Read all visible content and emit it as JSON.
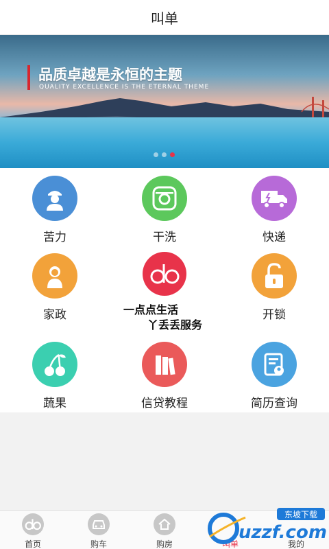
{
  "header": {
    "title": "叫单"
  },
  "banner": {
    "headline": "品质卓越是永恒的主题",
    "subline": "QUALITY EXCELLENCE IS THE ETERNAL THEME",
    "dots": 3,
    "active_dot": 3
  },
  "services": [
    {
      "label": "苦力",
      "icon": "worker-icon",
      "color": "#4a8fd6"
    },
    {
      "label": "干洗",
      "icon": "camera-icon",
      "color": "#5cc85c"
    },
    {
      "label": "快递",
      "icon": "delivery-truck-icon",
      "color": "#b76ad8"
    },
    {
      "label": "家政",
      "icon": "housekeeper-icon",
      "color": "#f2a23a"
    },
    {
      "label": "开锁",
      "icon": "unlock-icon",
      "color": "#f2a23a"
    },
    {
      "label": "蔬果",
      "icon": "cherry-icon",
      "color": "#3bcfb0"
    },
    {
      "label": "信贷教程",
      "icon": "books-icon",
      "color": "#ea5a5a"
    },
    {
      "label": "简历查询",
      "icon": "resume-icon",
      "color": "#4aa3e0"
    }
  ],
  "center": {
    "logo_text": "do",
    "slogan_line1": "一点点生活",
    "slogan_line2": "丫丢丢服务"
  },
  "tabbar": [
    {
      "label": "首页",
      "icon": "do-logo-icon"
    },
    {
      "label": "购车",
      "icon": "car-icon"
    },
    {
      "label": "购房",
      "icon": "house-icon"
    },
    {
      "label": "叫单",
      "icon": "order-icon",
      "active": true
    },
    {
      "label": "我的",
      "icon": "profile-icon"
    }
  ],
  "watermark": {
    "text": "uzzf.com",
    "tag": "东坡下载"
  }
}
